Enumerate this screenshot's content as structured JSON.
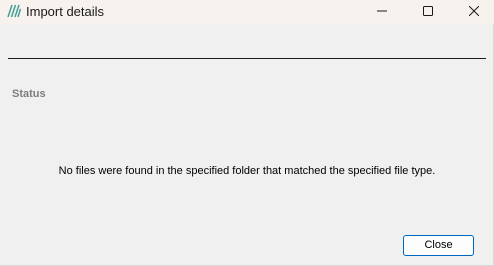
{
  "window": {
    "title": "Import details",
    "icon": "app-logo-icon",
    "controls": {
      "minimize_icon": "minimize-icon",
      "maximize_icon": "maximize-icon",
      "close_icon": "close-icon"
    }
  },
  "content": {
    "section_label": "Status",
    "message": "No files were found in the specified folder that matched the specified file type."
  },
  "footer": {
    "close_label": "Close"
  },
  "colors": {
    "titlebar_bg": "#f7f2ee",
    "window_bg": "#f0f0f0",
    "accent_border": "#0067c0",
    "logo": "#3a9c94",
    "section_label": "#7d7d7d"
  }
}
